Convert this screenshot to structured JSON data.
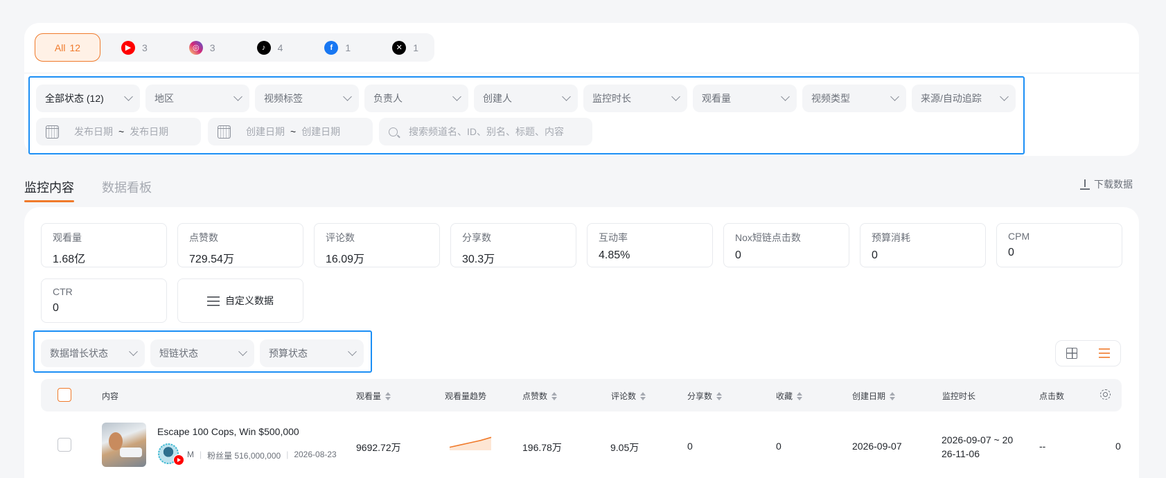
{
  "platforms": [
    {
      "name": "All",
      "count": "12",
      "icon": "all"
    },
    {
      "name": "YouTube",
      "count": "3",
      "icon": "youtube-icon",
      "color": "#ff0000"
    },
    {
      "name": "Instagram",
      "count": "3",
      "icon": "instagram-icon",
      "color": "#d6249f"
    },
    {
      "name": "TikTok",
      "count": "4",
      "icon": "tiktok-icon",
      "color": "#000000"
    },
    {
      "name": "Facebook",
      "count": "1",
      "icon": "facebook-icon",
      "color": "#1877f2"
    },
    {
      "name": "X",
      "count": "1",
      "icon": "x-icon",
      "color": "#000000"
    }
  ],
  "filters": {
    "status": "全部状态 (12)",
    "region": "地区",
    "video_tag": "视频标签",
    "owner": "负责人",
    "creator": "创建人",
    "monitor_duration": "监控时长",
    "views": "观看量",
    "video_type": "视频类型",
    "source": "来源/自动追踪",
    "publish_start": "发布日期",
    "publish_end": "发布日期",
    "create_start": "创建日期",
    "create_end": "创建日期",
    "range_sep": "~",
    "search_placeholder": "搜索频道名、ID、别名、标题、内容"
  },
  "tabs": {
    "monitor": "监控内容",
    "dashboard": "数据看板"
  },
  "download_label": "下载数据",
  "metrics": [
    {
      "label": "观看量",
      "value": "1.68亿"
    },
    {
      "label": "点赞数",
      "value": "729.54万"
    },
    {
      "label": "评论数",
      "value": "16.09万"
    },
    {
      "label": "分享数",
      "value": "30.3万"
    },
    {
      "label": "互动率",
      "value": "4.85%"
    },
    {
      "label": "Nox短链点击数",
      "value": "0"
    },
    {
      "label": "预算消耗",
      "value": "0"
    },
    {
      "label": "CPM",
      "value": "0"
    },
    {
      "label": "CTR",
      "value": "0"
    }
  ],
  "custom_data_label": "自定义数据",
  "sub_filters": {
    "growth": "数据增长状态",
    "shortlink": "短链状态",
    "budget": "预算状态"
  },
  "columns": {
    "content": "内容",
    "views": "观看量",
    "views_trend": "观看量趋势",
    "likes": "点赞数",
    "comments": "评论数",
    "shares": "分享数",
    "favorites": "收藏",
    "created": "创建日期",
    "monitor_duration": "监控时长",
    "clicks": "点击数"
  },
  "rows": [
    {
      "title": "Escape 100 Cops, Win $500,000",
      "channel_initial": "M",
      "followers": "粉丝量 516,000,000",
      "publish_date": "2026-08-23",
      "views": "9692.72万",
      "likes": "196.78万",
      "comments": "9.05万",
      "shares": "0",
      "favorites": "0",
      "created": "2026-09-07",
      "monitor_line1": "2026-09-07 ~ 20",
      "monitor_line2": "26-11-06",
      "clicks": "--",
      "extra": "0",
      "trend": [
        0.2,
        0.35,
        0.5,
        0.65,
        0.85
      ]
    }
  ],
  "colors": {
    "accent": "#f07a2b",
    "highlight_border": "#1c8ff5"
  }
}
